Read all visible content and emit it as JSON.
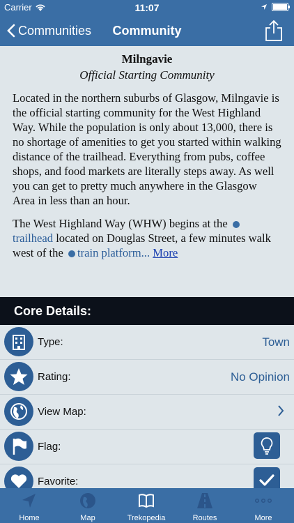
{
  "status": {
    "carrier": "Carrier",
    "time": "11:07"
  },
  "nav": {
    "back_label": "Communities",
    "title": "Community"
  },
  "article": {
    "heading": "Milngavie",
    "subheading": "Official Starting Community",
    "para1": "Located in the northern suburbs of Glasgow, Milngavie is the official starting community for the West Highland Way. While the population is only about 13,000, there is no shortage of amenities to get you started within walking distance of the trailhead. Everything from pubs, coffee shops, and food markets are literally steps away. As well you can get to pretty much anywhere in the Glasgow Area in less than an hour.",
    "para2_a": "The West Highland Way (WHW) begins at the ",
    "para2_link1": "trailhead",
    "para2_b": " located on Douglas Street, a few minutes walk west of the ",
    "para2_link2": "train platform...",
    "para2_more": "More"
  },
  "section": {
    "title": "Core Details:"
  },
  "details": [
    {
      "label": "Type:",
      "value": "Town",
      "icon": "building-icon"
    },
    {
      "label": "Rating:",
      "value": "No Opinion",
      "icon": "star-icon"
    },
    {
      "label": "View Map:",
      "value": "",
      "icon": "globe-icon"
    },
    {
      "label": "Flag:",
      "value": "",
      "icon": "flag-icon"
    },
    {
      "label": "Favorite:",
      "value": "",
      "icon": "heart-icon"
    }
  ],
  "tabs": [
    {
      "label": "Home",
      "icon": "navigation-arrow-icon"
    },
    {
      "label": "Map",
      "icon": "globe-icon"
    },
    {
      "label": "Trekopedia",
      "icon": "book-icon"
    },
    {
      "label": "Routes",
      "icon": "road-icon"
    },
    {
      "label": "More",
      "icon": "more-dots-icon"
    }
  ],
  "colors": {
    "bar": "#3a6ea5",
    "icon_circle": "#2d5e95",
    "section_bg": "#0c111a",
    "background": "#dfe6ea"
  }
}
